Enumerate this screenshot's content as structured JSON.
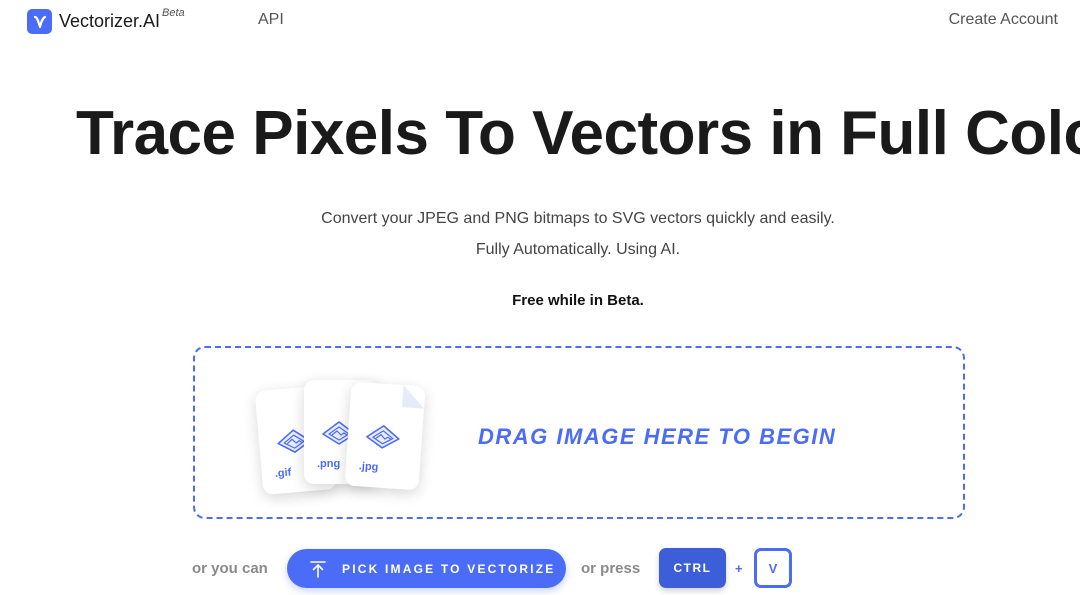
{
  "header": {
    "brand": "Vectorizer.AI",
    "beta": "Beta",
    "logo_letter": "v",
    "nav_api": "API",
    "create_account": "Create Account"
  },
  "hero": {
    "title": "Trace Pixels To Vectors in Full Color",
    "subtitle_line1": "Convert your JPEG and PNG bitmaps to SVG vectors quickly and easily.",
    "subtitle_line2": "Fully Automatically. Using AI.",
    "free_note": "Free while in Beta."
  },
  "dropzone": {
    "text": "DRAG IMAGE HERE TO BEGIN",
    "file_cards": [
      ".gif",
      ".png",
      ".jpg"
    ]
  },
  "actions": {
    "or_you_can": "or you can",
    "pick_button": "PICK IMAGE TO VECTORIZE",
    "or_press": "or press",
    "key_ctrl": "CTRL",
    "plus": "+",
    "key_v": "V"
  },
  "colors": {
    "accent": "#4a6cf7",
    "key_ctrl_bg": "#3c5fd9",
    "muted_text": "#8a8a8a"
  },
  "icons": {
    "logo": "vectorizer-logo-icon",
    "file_image": "image-file-icon",
    "upload": "upload-arrow-icon"
  }
}
